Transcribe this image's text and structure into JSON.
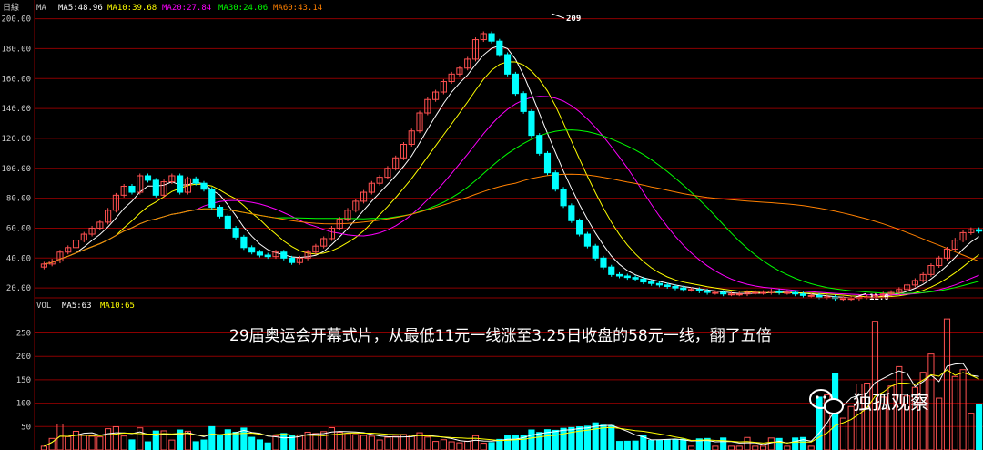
{
  "header": {
    "period": "日線",
    "ma_title": "MA",
    "ma5": "MA5:48.96",
    "ma10": "MA10:39.68",
    "ma20": "MA20:27.84",
    "ma30": "MA30:24.06",
    "ma60": "MA60:43.14"
  },
  "vol_header": {
    "title": "VOL",
    "ma5": "MA5:63",
    "ma10": "MA10:65"
  },
  "colors": {
    "bg": "#000000",
    "grid": "#8b0000",
    "up": "#ff5050",
    "down": "#00ffff",
    "ma5": "#ffffff",
    "ma10": "#ffff00",
    "ma20": "#ff00ff",
    "ma30": "#00ff00",
    "ma60": "#ff8000"
  },
  "annotation": "29届奥运会开幕式片，从最低11元一线涨至3.25日收盘的58元一线，翻了五倍",
  "watermark": {
    "icon": "wechat-icon",
    "text": "独孤观察"
  },
  "chart_data": {
    "type": "candlestick",
    "price_axis": {
      "ticks": [
        "200.00",
        "180.00",
        "160.00",
        "140.00",
        "120.00",
        "100.00",
        "80.00",
        "60.00",
        "40.00",
        "20.00"
      ],
      "ylim": [
        14,
        204
      ]
    },
    "vol_axis": {
      "ticks": [
        "250",
        "200",
        "150",
        "100",
        "50"
      ],
      "ylim": [
        0,
        290
      ]
    },
    "high_label": "209",
    "low_label": "11.6",
    "n": 80,
    "close": [
      36,
      38,
      44,
      47,
      52,
      56,
      60,
      64,
      72,
      82,
      88,
      84,
      95,
      92,
      82,
      91,
      95,
      84,
      93,
      90,
      86,
      74,
      68,
      60,
      54,
      47,
      44,
      42,
      41,
      44,
      40,
      37,
      40,
      44,
      48,
      53,
      60,
      66,
      72,
      78,
      84,
      90,
      94,
      100,
      107,
      116,
      125,
      137,
      146,
      151,
      158,
      163,
      167,
      173,
      186,
      190,
      185,
      176,
      163,
      150,
      138,
      122,
      110,
      97,
      86,
      75,
      65,
      56,
      48,
      40,
      34,
      29,
      28,
      27,
      26,
      24,
      23,
      22,
      21,
      20,
      19,
      19,
      18,
      17,
      17,
      16,
      16,
      16,
      17,
      17,
      17,
      18,
      17,
      17,
      16,
      15,
      15,
      14,
      14,
      13,
      13,
      13,
      14,
      14,
      15,
      16,
      17,
      19,
      22,
      25,
      29,
      35,
      40,
      46,
      52,
      57,
      59,
      58
    ],
    "open_note": "bodies show small gaps between open and close; thin bars represent doji-like days"
  }
}
